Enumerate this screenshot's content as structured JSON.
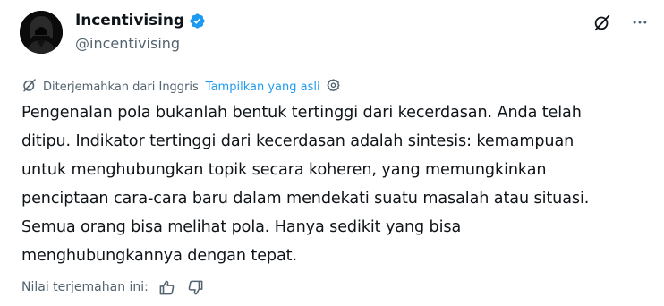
{
  "author": {
    "display_name": "Incentivising",
    "handle": "@incentivising",
    "verified": true,
    "avatar_icon": "hooded-figure-icon"
  },
  "translation": {
    "notice": "Diterjemahkan dari Inggris",
    "show_original": "Tampilkan yang asli"
  },
  "tweet": {
    "text": "Pengenalan pola bukanlah bentuk tertinggi dari kecerdasan. Anda telah\nditipu. Indikator tertinggi dari kecerdasan adalah sintesis: kemampuan\nuntuk menghubungkan topik secara koheren, yang memungkinkan\npenciptaan cara-cara baru dalam mendekati suatu masalah atau situasi.\nSemua orang bisa melihat pola. Hanya sedikit yang bisa\nmenghubungkannya dengan tepat."
  },
  "rating": {
    "label": "Nilai terjemahan ini:"
  },
  "colors": {
    "accent": "#1d9bf0",
    "secondary_text": "#536471",
    "primary_text": "#0f1419"
  }
}
